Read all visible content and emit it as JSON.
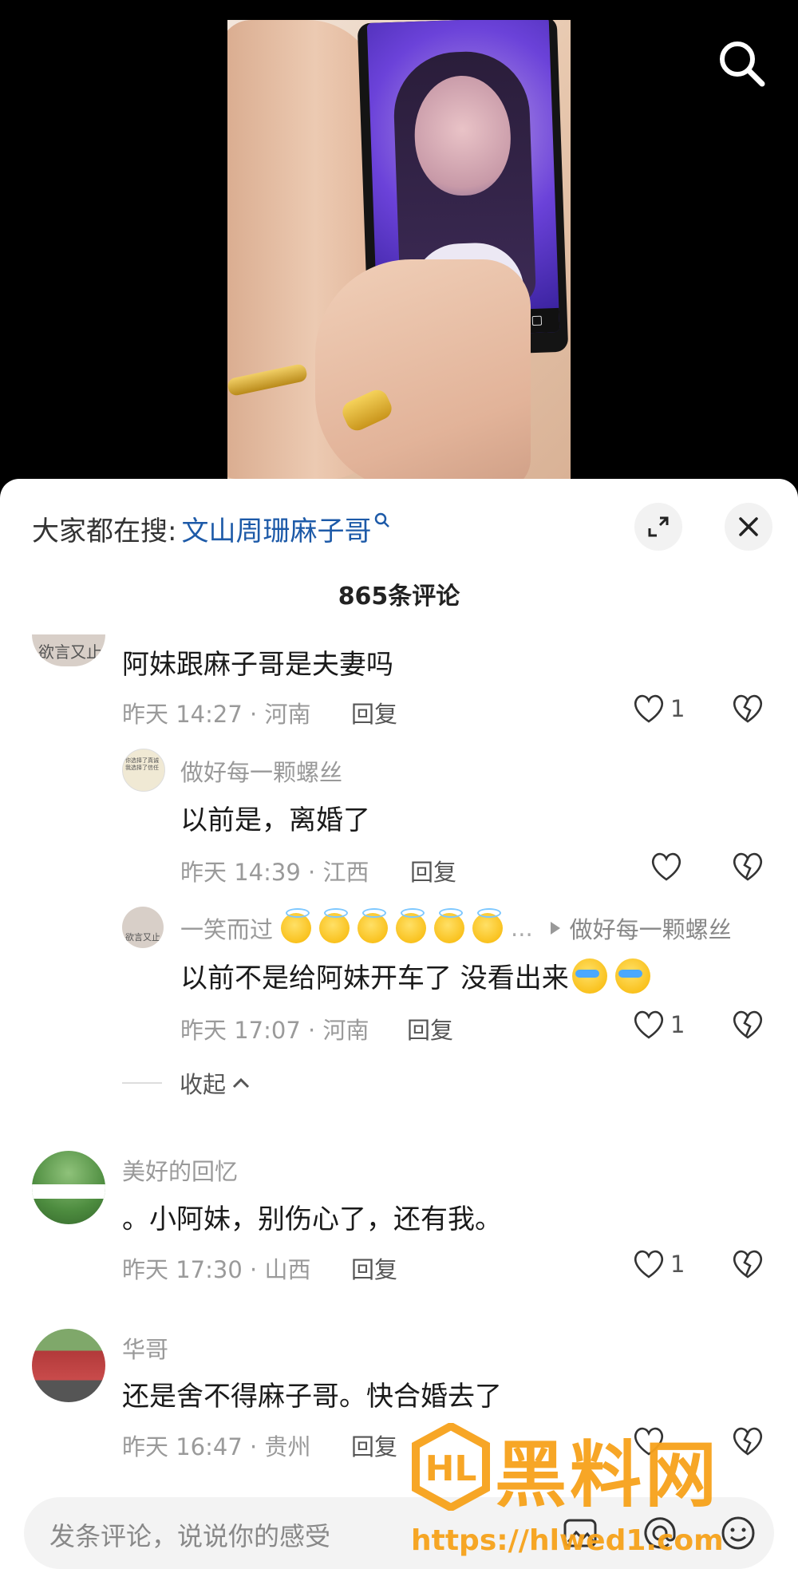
{
  "trend": {
    "prefix": "大家都在搜:",
    "term": "文山周珊麻子哥"
  },
  "comment_count": "865条评论",
  "comments": [
    {
      "avatar_text": "欲言又止",
      "text": "阿妹跟麻子哥是夫妻吗",
      "time_loc": "昨天 14:27 · 河南",
      "reply": "回复",
      "likes": "1"
    },
    {
      "user": "做好每一颗螺丝",
      "avatar_text": "你选择了真诚我选择了信任",
      "text": "以前是，离婚了",
      "time_loc": "昨天 14:39 · 江西",
      "reply": "回复",
      "likes": ""
    },
    {
      "user": "一笑而过",
      "reply_to": "做好每一颗螺丝",
      "ellipsis": "...",
      "avatar_text": "欲言又止",
      "text": "以前不是给阿妹开车了 没看出来",
      "time_loc": "昨天 17:07 · 河南",
      "reply": "回复",
      "likes": "1"
    },
    {
      "user": "美好的回忆",
      "text": "。小阿妹，别伤心了，还有我。",
      "time_loc": "昨天 17:30 · 山西",
      "reply": "回复",
      "likes": "1"
    },
    {
      "user": "华哥",
      "text": "还是舍不得麻子哥。快合婚去了",
      "time_loc": "昨天 16:47 · 贵州",
      "reply": "回复",
      "likes": ""
    }
  ],
  "collapse_label": "收起",
  "input": {
    "placeholder": "发条评论，说说你的感受"
  },
  "watermark": {
    "title": "黑料网",
    "url": "https://hlwed1.com"
  },
  "colors": {
    "link_blue": "#1d5aa8",
    "watermark_orange": "#f7a21b"
  }
}
